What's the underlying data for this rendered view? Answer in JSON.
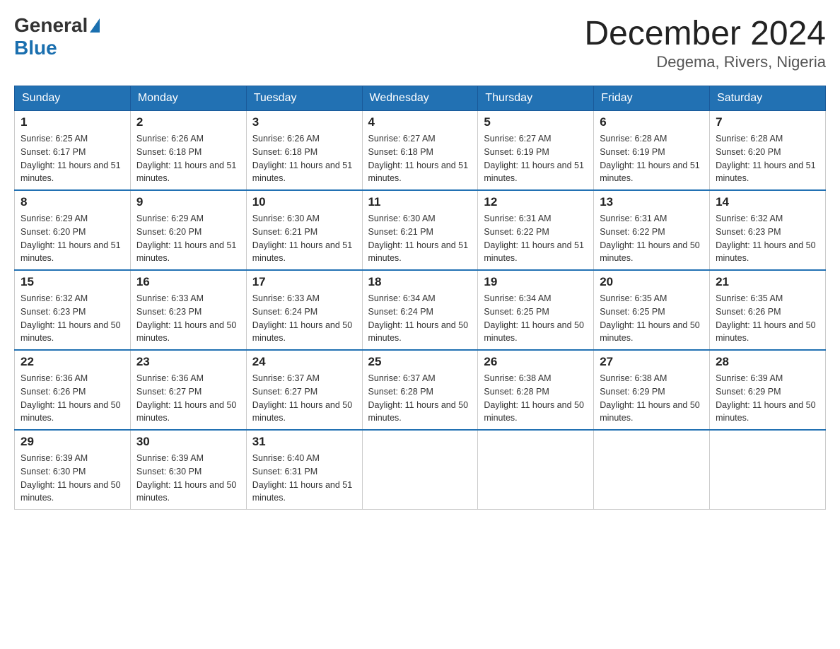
{
  "header": {
    "logo_general": "General",
    "logo_blue": "Blue",
    "title": "December 2024",
    "subtitle": "Degema, Rivers, Nigeria"
  },
  "days_of_week": [
    "Sunday",
    "Monday",
    "Tuesday",
    "Wednesday",
    "Thursday",
    "Friday",
    "Saturday"
  ],
  "weeks": [
    [
      {
        "day": "1",
        "sunrise": "6:25 AM",
        "sunset": "6:17 PM",
        "daylight": "11 hours and 51 minutes."
      },
      {
        "day": "2",
        "sunrise": "6:26 AM",
        "sunset": "6:18 PM",
        "daylight": "11 hours and 51 minutes."
      },
      {
        "day": "3",
        "sunrise": "6:26 AM",
        "sunset": "6:18 PM",
        "daylight": "11 hours and 51 minutes."
      },
      {
        "day": "4",
        "sunrise": "6:27 AM",
        "sunset": "6:18 PM",
        "daylight": "11 hours and 51 minutes."
      },
      {
        "day": "5",
        "sunrise": "6:27 AM",
        "sunset": "6:19 PM",
        "daylight": "11 hours and 51 minutes."
      },
      {
        "day": "6",
        "sunrise": "6:28 AM",
        "sunset": "6:19 PM",
        "daylight": "11 hours and 51 minutes."
      },
      {
        "day": "7",
        "sunrise": "6:28 AM",
        "sunset": "6:20 PM",
        "daylight": "11 hours and 51 minutes."
      }
    ],
    [
      {
        "day": "8",
        "sunrise": "6:29 AM",
        "sunset": "6:20 PM",
        "daylight": "11 hours and 51 minutes."
      },
      {
        "day": "9",
        "sunrise": "6:29 AM",
        "sunset": "6:20 PM",
        "daylight": "11 hours and 51 minutes."
      },
      {
        "day": "10",
        "sunrise": "6:30 AM",
        "sunset": "6:21 PM",
        "daylight": "11 hours and 51 minutes."
      },
      {
        "day": "11",
        "sunrise": "6:30 AM",
        "sunset": "6:21 PM",
        "daylight": "11 hours and 51 minutes."
      },
      {
        "day": "12",
        "sunrise": "6:31 AM",
        "sunset": "6:22 PM",
        "daylight": "11 hours and 51 minutes."
      },
      {
        "day": "13",
        "sunrise": "6:31 AM",
        "sunset": "6:22 PM",
        "daylight": "11 hours and 50 minutes."
      },
      {
        "day": "14",
        "sunrise": "6:32 AM",
        "sunset": "6:23 PM",
        "daylight": "11 hours and 50 minutes."
      }
    ],
    [
      {
        "day": "15",
        "sunrise": "6:32 AM",
        "sunset": "6:23 PM",
        "daylight": "11 hours and 50 minutes."
      },
      {
        "day": "16",
        "sunrise": "6:33 AM",
        "sunset": "6:23 PM",
        "daylight": "11 hours and 50 minutes."
      },
      {
        "day": "17",
        "sunrise": "6:33 AM",
        "sunset": "6:24 PM",
        "daylight": "11 hours and 50 minutes."
      },
      {
        "day": "18",
        "sunrise": "6:34 AM",
        "sunset": "6:24 PM",
        "daylight": "11 hours and 50 minutes."
      },
      {
        "day": "19",
        "sunrise": "6:34 AM",
        "sunset": "6:25 PM",
        "daylight": "11 hours and 50 minutes."
      },
      {
        "day": "20",
        "sunrise": "6:35 AM",
        "sunset": "6:25 PM",
        "daylight": "11 hours and 50 minutes."
      },
      {
        "day": "21",
        "sunrise": "6:35 AM",
        "sunset": "6:26 PM",
        "daylight": "11 hours and 50 minutes."
      }
    ],
    [
      {
        "day": "22",
        "sunrise": "6:36 AM",
        "sunset": "6:26 PM",
        "daylight": "11 hours and 50 minutes."
      },
      {
        "day": "23",
        "sunrise": "6:36 AM",
        "sunset": "6:27 PM",
        "daylight": "11 hours and 50 minutes."
      },
      {
        "day": "24",
        "sunrise": "6:37 AM",
        "sunset": "6:27 PM",
        "daylight": "11 hours and 50 minutes."
      },
      {
        "day": "25",
        "sunrise": "6:37 AM",
        "sunset": "6:28 PM",
        "daylight": "11 hours and 50 minutes."
      },
      {
        "day": "26",
        "sunrise": "6:38 AM",
        "sunset": "6:28 PM",
        "daylight": "11 hours and 50 minutes."
      },
      {
        "day": "27",
        "sunrise": "6:38 AM",
        "sunset": "6:29 PM",
        "daylight": "11 hours and 50 minutes."
      },
      {
        "day": "28",
        "sunrise": "6:39 AM",
        "sunset": "6:29 PM",
        "daylight": "11 hours and 50 minutes."
      }
    ],
    [
      {
        "day": "29",
        "sunrise": "6:39 AM",
        "sunset": "6:30 PM",
        "daylight": "11 hours and 50 minutes."
      },
      {
        "day": "30",
        "sunrise": "6:39 AM",
        "sunset": "6:30 PM",
        "daylight": "11 hours and 50 minutes."
      },
      {
        "day": "31",
        "sunrise": "6:40 AM",
        "sunset": "6:31 PM",
        "daylight": "11 hours and 51 minutes."
      },
      null,
      null,
      null,
      null
    ]
  ]
}
